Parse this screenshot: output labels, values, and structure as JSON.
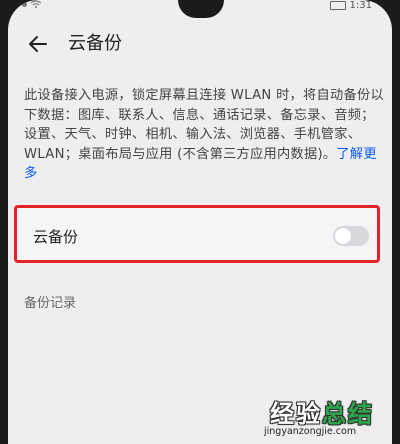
{
  "status_bar": {
    "time": "1:31"
  },
  "header": {
    "title": "云备份"
  },
  "description": {
    "text": "此设备接入电源，锁定屏幕且连接 WLAN 时，将自动备份以下数据：图库、联系人、信息、通话记录、备忘录、音频；设置、天气、时钟、相机、输入法、浏览器、手机管家、WLAN；桌面布局与应用 (不含第三方应用内数据)。",
    "learn_more": "了解更多"
  },
  "cloud_backup": {
    "label": "云备份",
    "enabled": false
  },
  "backup_records": {
    "label": "备份记录"
  },
  "watermark": {
    "brand_prefix": "经验",
    "brand_accent": "总结",
    "url": "jingyanzongjie.com"
  }
}
